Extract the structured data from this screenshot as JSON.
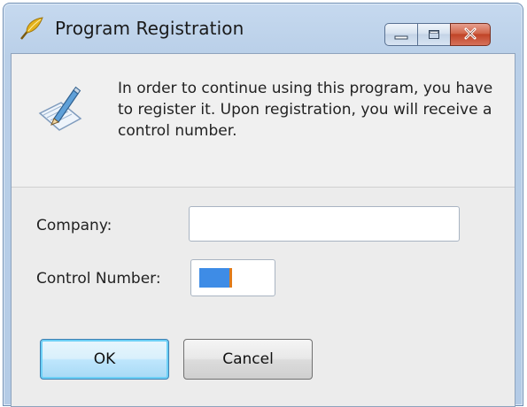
{
  "window": {
    "title": "Program Registration"
  },
  "titlebar_controls": {
    "minimize": "minimize-icon",
    "maximize": "maximize-icon",
    "close": "close-icon"
  },
  "banner": {
    "icon": "registration-pen-icon",
    "message": "In order to continue using this program, you have to register it.  Upon registration, you will receive a control number."
  },
  "form": {
    "company_label": "Company:",
    "company_value": "",
    "control_number_label": "Control Number:",
    "control_number_value": ""
  },
  "buttons": {
    "ok_label": "OK",
    "cancel_label": "Cancel"
  },
  "colors": {
    "titlebar": "#c6d9ef",
    "selection": "#3e8ce6",
    "close_button": "#c04427"
  }
}
